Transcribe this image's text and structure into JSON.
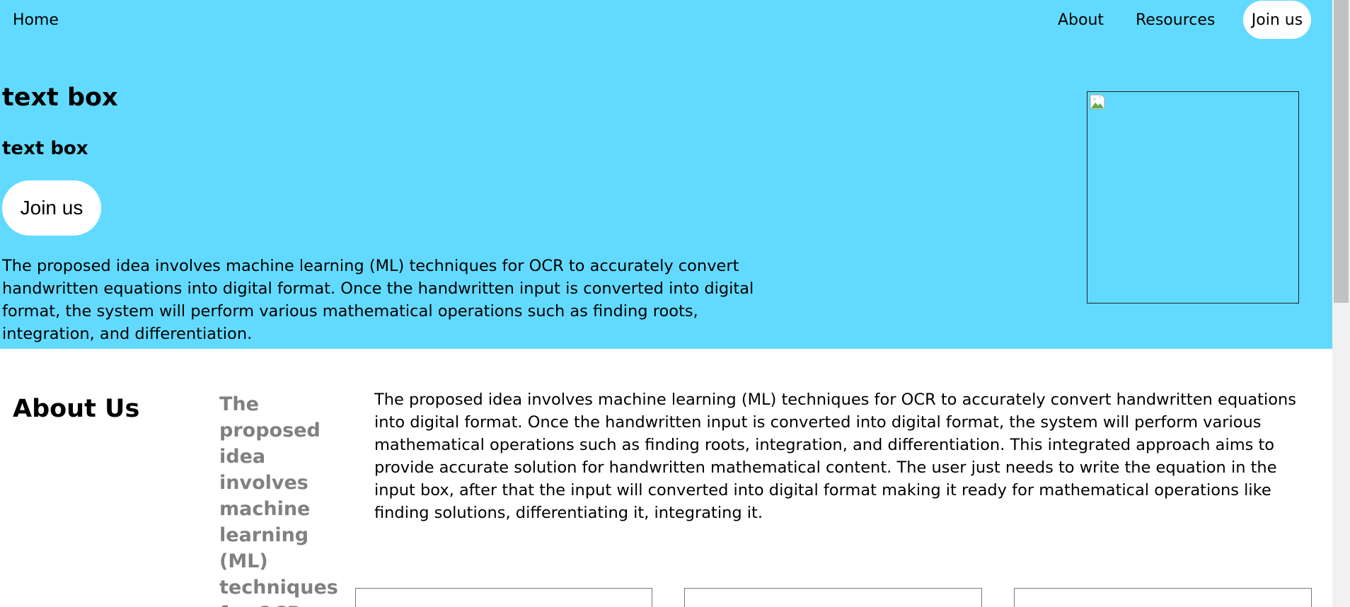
{
  "nav": {
    "home_label": "Home",
    "about_label": "About",
    "resources_label": "Resources",
    "join_label": "Join us"
  },
  "hero": {
    "title": "text box",
    "subtitle": "text box",
    "join_label": "Join us",
    "description": "The proposed idea involves machine learning (ML) techniques for OCR to accurately convert handwritten equations into digital format. Once the handwritten input is converted into digital format, the system will perform various mathematical operations such as finding roots, integration, and differentiation.",
    "background_color": "#62daff",
    "image_icon": "broken-image-icon"
  },
  "about": {
    "heading": "About Us",
    "highlight": "The proposed idea involves machine learning (ML) techniques for OCR",
    "highlight_color": "#808080",
    "body": "The proposed idea involves machine learning (ML) techniques for OCR to accurately convert handwritten equations into digital format. Once the handwritten input is converted into digital format, the system will perform various mathematical operations such as finding roots, integration, and differentiation. This integrated approach aims to provide accurate solution for handwritten mathematical content. The user just needs to write the equation in the input box, after that the input will converted into digital format making it ready for mathematical operations like finding solutions, differentiating it, integrating it."
  }
}
